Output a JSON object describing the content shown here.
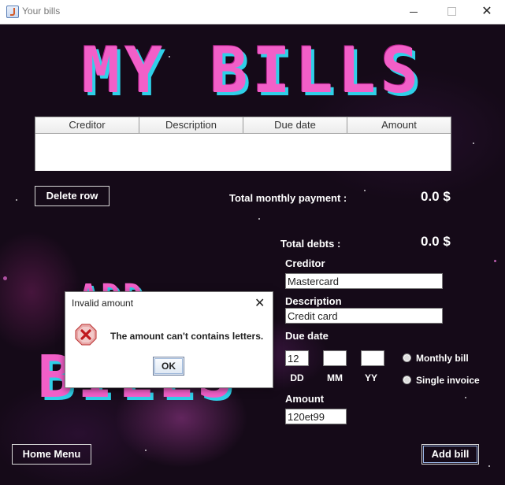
{
  "window": {
    "title": "Your bills",
    "minimize_glyph": "—",
    "maximize_glyph": "☐",
    "close_glyph": "✕"
  },
  "header": {
    "title": "MY BILLS"
  },
  "background_text": {
    "line1": "ADD",
    "line2": "BILLS"
  },
  "table": {
    "columns": [
      "Creditor",
      "Description",
      "Due date",
      "Amount"
    ],
    "rows": []
  },
  "buttons": {
    "delete_row": "Delete row",
    "home_menu": "Home Menu",
    "add_bill": "Add bill"
  },
  "totals": {
    "monthly_label": "Total monthly payment :",
    "monthly_value": "0.0 $",
    "debts_label": "Total debts :",
    "debts_value": "0.0 $"
  },
  "form": {
    "creditor_label": "Creditor",
    "creditor_value": "Mastercard",
    "description_label": "Description",
    "description_value": "Credit card",
    "due_date_label": "Due date",
    "day_value": "12",
    "month_value": "",
    "year_value": "",
    "day_label": "DD",
    "month_label": "MM",
    "year_label": "YY",
    "monthly_bill_label": "Monthly bill",
    "single_invoice_label": "Single invoice",
    "amount_label": "Amount",
    "amount_value": "120et99"
  },
  "dialog": {
    "title": "Invalid amount",
    "message": "The amount can't contains letters.",
    "ok_label": "OK",
    "icon": "error-icon"
  },
  "colors": {
    "title_pink": "#f25fc8",
    "title_shadow_cyan": "#2fd0e8",
    "background": "#150a18",
    "error_red": "#d9534f"
  }
}
